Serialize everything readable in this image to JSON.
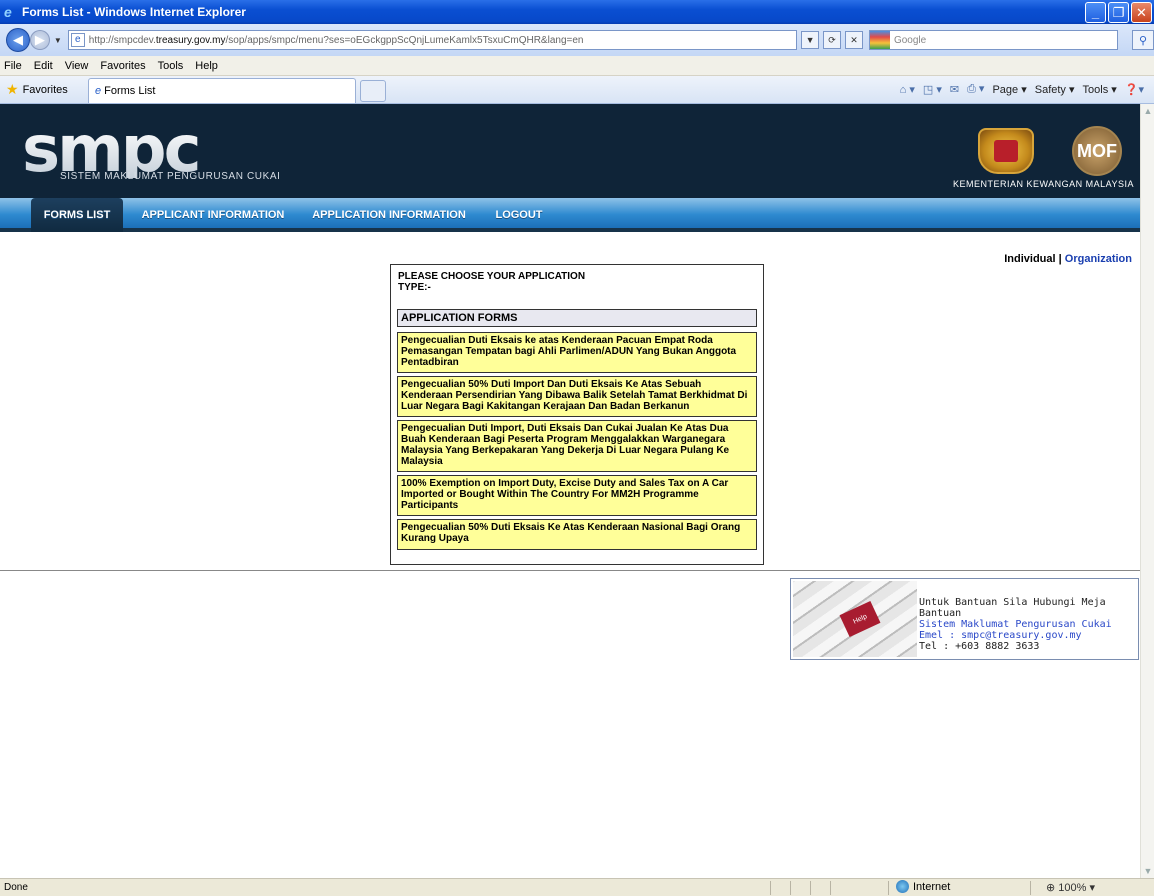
{
  "window": {
    "title": "Forms List - Windows Internet Explorer"
  },
  "browser": {
    "url_prefix": "http://smpcdev.",
    "url_host": "treasury.gov.my",
    "url_path": "/sop/apps/smpc/menu?ses=oEGckgppScQnjLumeKamlx5TsxuCmQHR&lang=en",
    "search_placeholder": "Google",
    "menu": [
      "File",
      "Edit",
      "View",
      "Favorites",
      "Tools",
      "Help"
    ],
    "favorites_label": "Favorites",
    "tab_title": "Forms List",
    "commands": {
      "page": "Page",
      "safety": "Safety",
      "tools": "Tools"
    }
  },
  "site": {
    "logo": "smpc",
    "logo_subtitle": "SISTEM MAKLUMAT PENGURUSAN CUKAI",
    "mof_badge": "MOF",
    "ministry": "KEMENTERIAN KEWANGAN MALAYSIA",
    "nav": [
      "FORMS LIST",
      "APPLICANT INFORMATION",
      "APPLICATION INFORMATION",
      "LOGOUT"
    ]
  },
  "applicant_type": {
    "individual": "Individual",
    "separator": "|",
    "organization": "Organization"
  },
  "panel": {
    "prompt": "PLEASE CHOOSE YOUR APPLICATION TYPE:-",
    "header": "APPLICATION FORMS",
    "forms": [
      "Pengecualian Duti Eksais ke atas Kenderaan Pacuan Empat Roda Pemasangan Tempatan bagi Ahli Parlimen/ADUN Yang Bukan Anggota Pentadbiran",
      "Pengecualian 50% Duti Import Dan Duti Eksais Ke Atas Sebuah Kenderaan Persendirian Yang Dibawa Balik Setelah Tamat Berkhidmat Di Luar Negara Bagi Kakitangan Kerajaan Dan Badan Berkanun",
      "Pengecualian Duti Import, Duti Eksais Dan Cukai Jualan Ke Atas Dua Buah Kenderaan Bagi Peserta Program Menggalakkan Warganegara Malaysia Yang Berkepakaran Yang Dekerja Di Luar Negara Pulang Ke Malaysia",
      "100% Exemption on Import Duty, Excise Duty and Sales Tax on A Car Imported or Bought Within The Country For MM2H Programme Participants",
      "Pengecualian 50% Duti Eksais Ke Atas Kenderaan Nasional Bagi Orang Kurang Upaya"
    ]
  },
  "help": {
    "key_label": "Help",
    "line1": "Untuk Bantuan Sila Hubungi Meja Bantuan",
    "line2": "Sistem Maklumat Pengurusan Cukai",
    "line3": "Emel : smpc@treasury.gov.my",
    "line4": "Tel : +603 8882 3633"
  },
  "status": {
    "text": "Done",
    "zone": "Internet",
    "zoom": "100%"
  },
  "colors": {
    "banner": "#0f2438",
    "nav": "#2e8ad0",
    "form_bg": "#ffff99",
    "link": "#1a3fb0"
  }
}
